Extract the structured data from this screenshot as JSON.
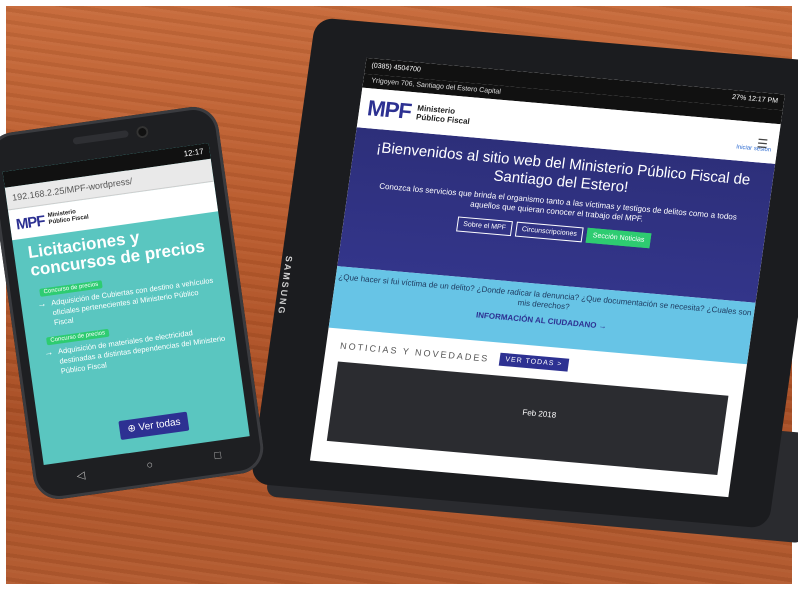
{
  "phone": {
    "status_time": "12:17",
    "url": "192.168.2.25/MPF-wordpress/",
    "logo": {
      "mark": "MPF",
      "line1": "Ministerio",
      "line2": "Público Fiscal"
    },
    "page_title": "Licitaciones y concursos de precios",
    "items": [
      {
        "badge": "Concurso de precios",
        "text": "Adquisición de Cubiertas con destino a vehículos oficiales pertenecientes al Ministerio Público Fiscal"
      },
      {
        "badge": "Concurso de precios",
        "text": "Adquisición de materiales de electricidad destinadas a distintas dependencias del Ministerio Público Fiscal"
      }
    ],
    "button_label": "Ver todas"
  },
  "tablet": {
    "brand": "SAMSUNG",
    "status": "27% 12:17 PM",
    "phone_number": "(0385) 4504700",
    "address": "Yrigoyen 706, Santiago del Estero Capital",
    "login": "Iniciar sesión",
    "logo": {
      "mark": "MPF",
      "line1": "Ministerio",
      "line2": "Público Fiscal"
    },
    "hero_title": "¡Bienvenidos al sitio web del Ministerio Público Fiscal de Santiago del Estero!",
    "hero_text": "Conozca los servicios que brinda el organismo tanto a las víctimas y testigos de delitos como a todos aquellos que quieran conocer el trabajo del MPF.",
    "buttons": [
      "Sobre el MPF",
      "Circunscripciones",
      "Sección Noticias"
    ],
    "info_text": "¿Que hacer si fui víctima de un delito? ¿Donde radicar la denuncia? ¿Que documentación se necesita? ¿Cuales son mis derechos?",
    "info_cta": "INFORMACIÓN AL CIUDADANO →",
    "news_label": "NOTICIAS Y NOVEDADES",
    "news_button": "VER TODAS >",
    "post_date": "Feb 2018"
  },
  "colors": {
    "brand_blue": "#2d3192",
    "teal": "#5ac6c0",
    "green": "#2ecc71",
    "info_blue": "#67c4e6",
    "table_wood": "#b85a2c"
  }
}
